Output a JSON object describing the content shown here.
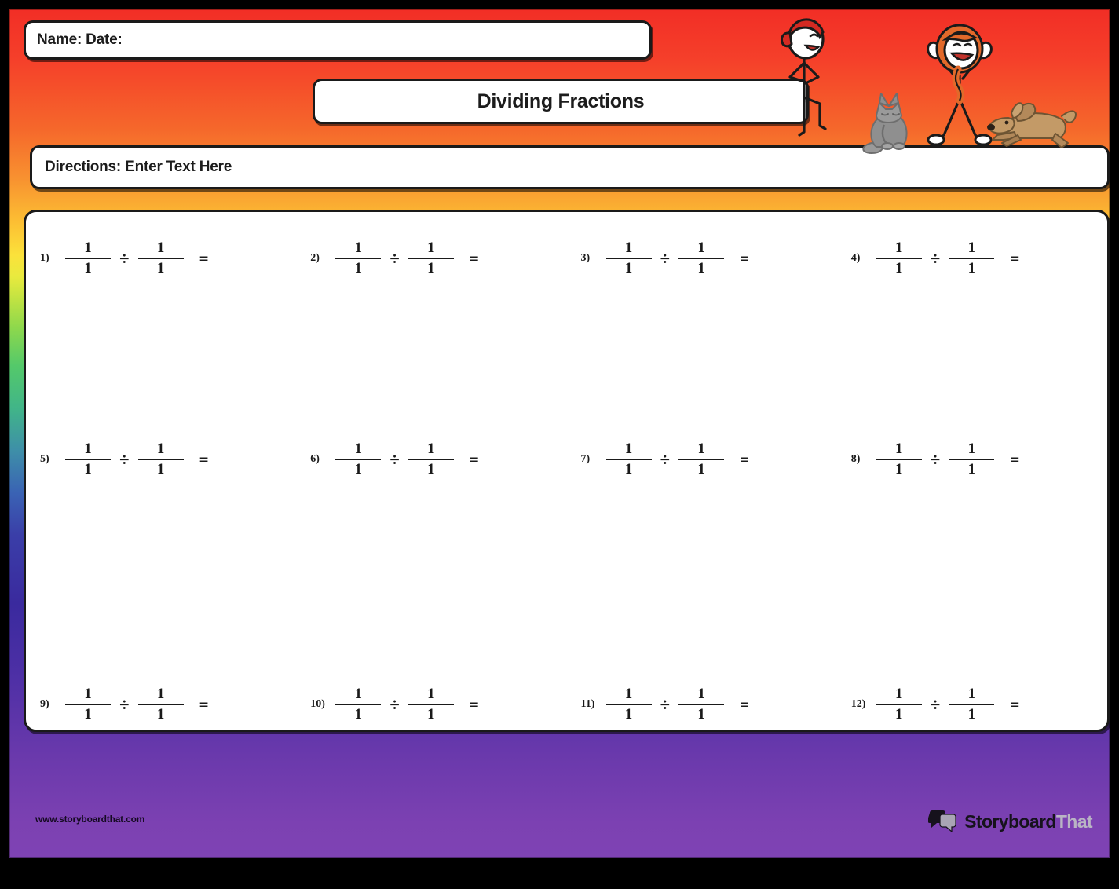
{
  "worksheet": {
    "name_date_label": "Name: Date:",
    "title": "Dividing Fractions",
    "directions": "Directions: Enter Text Here"
  },
  "problems": [
    {
      "number": "1)",
      "numerator_a": "1",
      "denominator_a": "1",
      "operator": "÷",
      "numerator_b": "1",
      "denominator_b": "1",
      "equals": "="
    },
    {
      "number": "2)",
      "numerator_a": "1",
      "denominator_a": "1",
      "operator": "÷",
      "numerator_b": "1",
      "denominator_b": "1",
      "equals": "="
    },
    {
      "number": "3)",
      "numerator_a": "1",
      "denominator_a": "1",
      "operator": "÷",
      "numerator_b": "1",
      "denominator_b": "1",
      "equals": "="
    },
    {
      "number": "4)",
      "numerator_a": "1",
      "denominator_a": "1",
      "operator": "÷",
      "numerator_b": "1",
      "denominator_b": "1",
      "equals": "="
    },
    {
      "number": "5)",
      "numerator_a": "1",
      "denominator_a": "1",
      "operator": "÷",
      "numerator_b": "1",
      "denominator_b": "1",
      "equals": "="
    },
    {
      "number": "6)",
      "numerator_a": "1",
      "denominator_a": "1",
      "operator": "÷",
      "numerator_b": "1",
      "denominator_b": "1",
      "equals": "="
    },
    {
      "number": "7)",
      "numerator_a": "1",
      "denominator_a": "1",
      "operator": "÷",
      "numerator_b": "1",
      "denominator_b": "1",
      "equals": "="
    },
    {
      "number": "8)",
      "numerator_a": "1",
      "denominator_a": "1",
      "operator": "÷",
      "numerator_b": "1",
      "denominator_b": "1",
      "equals": "="
    },
    {
      "number": "9)",
      "numerator_a": "1",
      "denominator_a": "1",
      "operator": "÷",
      "numerator_b": "1",
      "denominator_b": "1",
      "equals": "="
    },
    {
      "number": "10)",
      "numerator_a": "1",
      "denominator_a": "1",
      "operator": "÷",
      "numerator_b": "1",
      "denominator_b": "1",
      "equals": "="
    },
    {
      "number": "11)",
      "numerator_a": "1",
      "denominator_a": "1",
      "operator": "÷",
      "numerator_b": "1",
      "denominator_b": "1",
      "equals": "="
    },
    {
      "number": "12)",
      "numerator_a": "1",
      "denominator_a": "1",
      "operator": "÷",
      "numerator_b": "1",
      "denominator_b": "1",
      "equals": "="
    }
  ],
  "footer": {
    "url": "www.storyboardthat.com",
    "logo_word_1": "Storyboard",
    "logo_word_2": "That"
  },
  "illustrations": [
    {
      "name": "boy-with-red-cap"
    },
    {
      "name": "gray-cat"
    },
    {
      "name": "girl-with-orange-hair"
    },
    {
      "name": "tan-dog"
    }
  ],
  "colors": {
    "gradient_top": "#f22e26",
    "gradient_mid_yellow": "#fbe23b",
    "gradient_mid_green": "#54c96a",
    "gradient_bottom": "#7f43b4",
    "ink": "#1a1a1a",
    "paper": "#ffffff",
    "cap_red": "#d42a22",
    "hair_orange": "#e2692a",
    "cat_gray": "#8f8f8f",
    "dog_tan": "#c39a67"
  }
}
